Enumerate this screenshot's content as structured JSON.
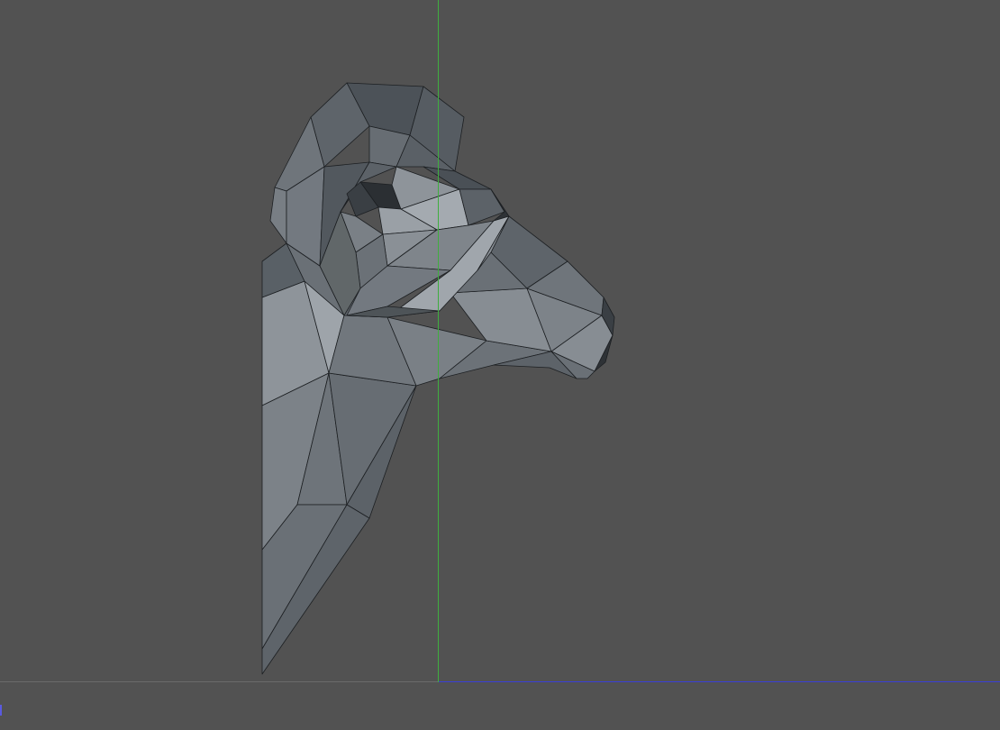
{
  "viewport": {
    "background": "#525252",
    "axis_colors": {
      "y_axis": "#3fae3f",
      "x_axis": "#3a3fd8"
    },
    "model": {
      "name": "ram-head-low-poly",
      "base_color": "#6b727a",
      "edge_color": "#1c1f22"
    }
  }
}
